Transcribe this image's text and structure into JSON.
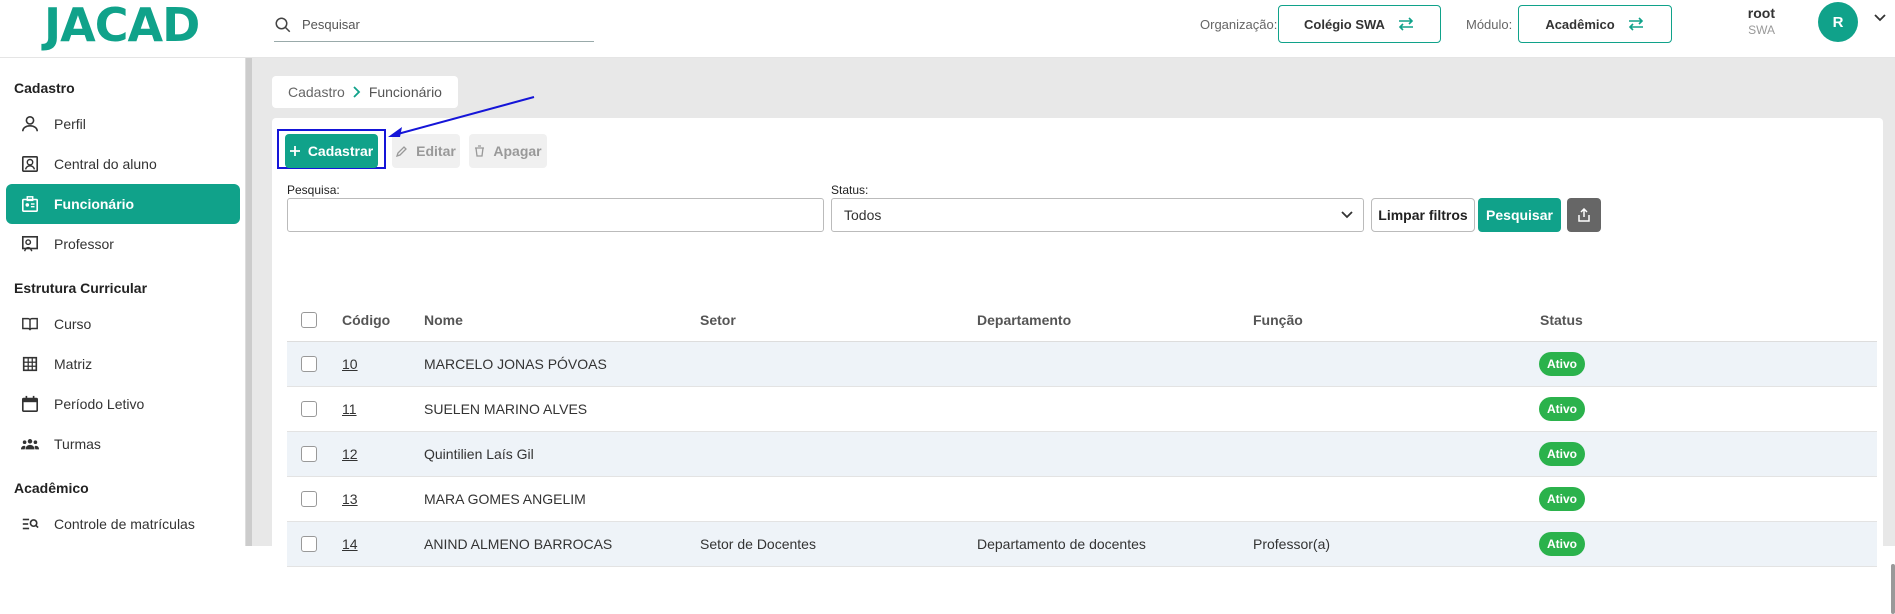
{
  "app": {
    "logo": "JACAD"
  },
  "topbar": {
    "search_placeholder": "Pesquisar",
    "org_label": "Organização:",
    "org_value": "Colégio SWA",
    "module_label": "Módulo:",
    "module_value": "Acadêmico",
    "user_name": "root",
    "user_org": "SWA",
    "avatar_letter": "R"
  },
  "sidebar": {
    "sections": [
      {
        "title": "Cadastro",
        "items": [
          {
            "label": "Perfil",
            "icon": "person-icon"
          },
          {
            "label": "Central do aluno",
            "icon": "student-card-icon"
          },
          {
            "label": "Funcionário",
            "icon": "badge-icon",
            "active": true
          },
          {
            "label": "Professor",
            "icon": "teacher-icon"
          }
        ]
      },
      {
        "title": "Estrutura Curricular",
        "items": [
          {
            "label": "Curso",
            "icon": "book-icon"
          },
          {
            "label": "Matriz",
            "icon": "grid-icon"
          },
          {
            "label": "Período Letivo",
            "icon": "calendar-icon"
          },
          {
            "label": "Turmas",
            "icon": "groups-icon"
          }
        ]
      },
      {
        "title": "Acadêmico",
        "items": [
          {
            "label": "Controle de matrículas",
            "icon": "list-search-icon"
          }
        ]
      }
    ]
  },
  "breadcrumb": {
    "parent": "Cadastro",
    "current": "Funcionário"
  },
  "toolbar": {
    "create": "Cadastrar",
    "edit": "Editar",
    "delete": "Apagar"
  },
  "filters": {
    "search_label": "Pesquisa:",
    "search_value": "",
    "status_label": "Status:",
    "status_value": "Todos",
    "clear_label": "Limpar filtros",
    "search_button": "Pesquisar"
  },
  "table": {
    "headers": {
      "code": "Código",
      "name": "Nome",
      "sector": "Setor",
      "department": "Departamento",
      "role": "Função",
      "status": "Status"
    },
    "rows": [
      {
        "code": "10",
        "name": "MARCELO JONAS PÓVOAS",
        "sector": "",
        "department": "",
        "role": "",
        "status": "Ativo"
      },
      {
        "code": "11",
        "name": "SUELEN MARINO ALVES",
        "sector": "",
        "department": "",
        "role": "",
        "status": "Ativo"
      },
      {
        "code": "12",
        "name": "Quintilien Laís Gil",
        "sector": "",
        "department": "",
        "role": "",
        "status": "Ativo"
      },
      {
        "code": "13",
        "name": "MARA GOMES ANGELIM",
        "sector": "",
        "department": "",
        "role": "",
        "status": "Ativo"
      },
      {
        "code": "14",
        "name": "ANIND ALMENO BARROCAS",
        "sector": "Setor de Docentes",
        "department": "Departamento de docentes",
        "role": "Professor(a)",
        "status": "Ativo"
      }
    ]
  },
  "colors": {
    "accent": "#10a28a",
    "active_badge": "#2bb24c",
    "highlight": "#1515d8"
  }
}
